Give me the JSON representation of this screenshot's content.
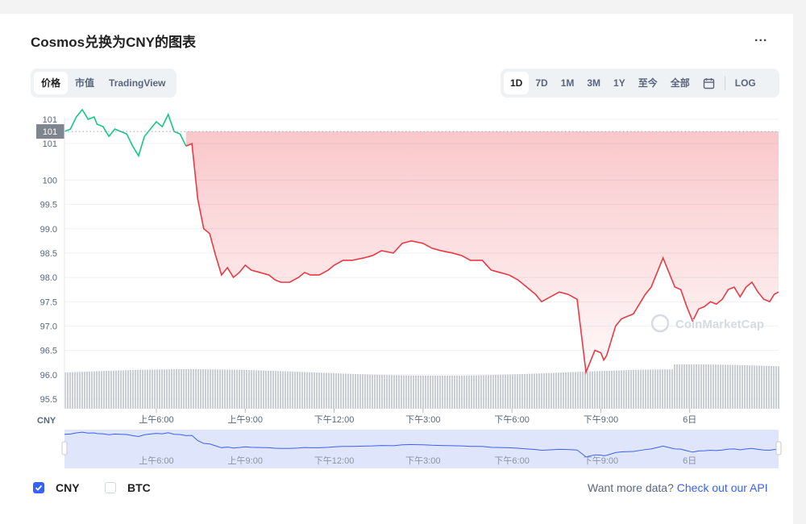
{
  "title": "Cosmos兑换为CNY的图表",
  "more_label": "...",
  "view_tabs": [
    {
      "label": "价格",
      "active": true
    },
    {
      "label": "市值",
      "active": false
    },
    {
      "label": "TradingView",
      "active": false
    }
  ],
  "range_tabs": [
    {
      "label": "1D",
      "active": true
    },
    {
      "label": "7D",
      "active": false
    },
    {
      "label": "1M",
      "active": false
    },
    {
      "label": "3M",
      "active": false
    },
    {
      "label": "1Y",
      "active": false
    },
    {
      "label": "至今",
      "active": false
    },
    {
      "label": "全部",
      "active": false
    }
  ],
  "log_label": "LOG",
  "legend": [
    {
      "label": "CNY",
      "checked": true
    },
    {
      "label": "BTC",
      "checked": false
    }
  ],
  "api_prompt": "Want more data?",
  "api_link": "Check out our API",
  "watermark": "CoinMarketCap",
  "colors": {
    "up": "#16c784",
    "down": "#ea3943",
    "accent": "#3861fb",
    "volume": "#c9ced6",
    "navigator_line": "#3861fb",
    "navigator_fill": "#dfe6fb"
  },
  "chart_data": {
    "type": "line",
    "ylabel": "CNY",
    "ylim": [
      95.3,
      101.3
    ],
    "ytick_labels": [
      "101",
      "101",
      "100",
      "99.5",
      "99.0",
      "98.5",
      "98.0",
      "97.5",
      "97.0",
      "96.5",
      "96.0",
      "95.5"
    ],
    "ytick_values": [
      101.25,
      100.75,
      100.0,
      99.5,
      99.0,
      98.5,
      98.0,
      97.5,
      97.0,
      96.5,
      96.0,
      95.5
    ],
    "reference_price": 101.0,
    "reference_label": "101",
    "x_ticks": [
      {
        "label": "上午6:00",
        "x": 6
      },
      {
        "label": "上午9:00",
        "x": 9
      },
      {
        "label": "下午12:00",
        "x": 12
      },
      {
        "label": "下午3:00",
        "x": 15
      },
      {
        "label": "下午6:00",
        "x": 18
      },
      {
        "label": "下午9:00",
        "x": 21
      },
      {
        "label": "6日",
        "x": 24
      }
    ],
    "xlim": [
      2.9,
      27.0
    ],
    "series": [
      {
        "x": [
          2.9,
          3.1,
          3.3,
          3.5,
          3.7,
          3.9,
          4.0,
          4.2,
          4.4,
          4.6,
          4.8,
          5.0,
          5.2,
          5.4,
          5.6,
          5.8,
          6.0,
          6.2,
          6.4,
          6.6,
          6.8,
          7.0,
          7.2,
          7.4,
          7.6,
          7.8,
          8.0,
          8.2,
          8.4,
          8.6,
          8.8,
          9.0,
          9.2,
          9.5,
          9.8,
          10.0,
          10.2,
          10.5,
          10.8,
          11.0,
          11.2,
          11.5,
          11.8,
          12.0,
          12.3,
          12.6,
          13.0,
          13.3,
          13.6,
          14.0,
          14.3,
          14.6,
          15.0,
          15.3,
          15.6,
          16.0,
          16.3,
          16.6,
          17.0,
          17.3,
          17.6,
          17.9,
          18.2,
          18.5,
          18.8,
          19.0,
          19.3,
          19.6,
          19.9,
          20.2,
          20.5,
          20.8,
          21.0,
          21.1,
          21.2,
          21.3,
          21.5,
          21.7,
          21.9,
          22.1,
          22.3,
          22.5,
          22.7,
          22.9,
          23.1,
          23.3,
          23.5,
          23.7,
          23.9,
          24.1,
          24.3,
          24.5,
          24.7,
          24.9,
          25.1,
          25.3,
          25.5,
          25.7,
          25.9,
          26.1,
          26.3,
          26.5,
          26.7,
          26.85,
          27.0
        ],
        "y": [
          101.0,
          101.05,
          101.3,
          101.45,
          101.25,
          101.3,
          101.15,
          101.1,
          100.9,
          101.05,
          101.0,
          100.95,
          100.7,
          100.5,
          100.9,
          101.05,
          101.2,
          101.1,
          101.35,
          101.0,
          100.95,
          100.7,
          100.75,
          99.6,
          99.0,
          98.9,
          98.45,
          98.05,
          98.2,
          98.0,
          98.1,
          98.25,
          98.15,
          98.1,
          98.05,
          97.95,
          97.9,
          97.9,
          98.0,
          98.1,
          98.05,
          98.05,
          98.15,
          98.25,
          98.35,
          98.35,
          98.4,
          98.45,
          98.55,
          98.5,
          98.7,
          98.75,
          98.7,
          98.6,
          98.55,
          98.5,
          98.45,
          98.35,
          98.35,
          98.15,
          98.1,
          98.05,
          97.95,
          97.8,
          97.65,
          97.5,
          97.6,
          97.7,
          97.65,
          97.55,
          96.05,
          96.5,
          96.45,
          96.3,
          96.4,
          96.6,
          97.0,
          97.15,
          97.2,
          97.25,
          97.45,
          97.65,
          97.8,
          98.1,
          98.4,
          98.1,
          97.8,
          97.75,
          97.4,
          97.1,
          97.35,
          97.4,
          97.5,
          97.45,
          97.55,
          97.75,
          97.8,
          97.6,
          97.8,
          97.9,
          97.7,
          97.55,
          97.5,
          97.65,
          97.7
        ]
      }
    ],
    "grid": true,
    "volume_panel": true
  }
}
